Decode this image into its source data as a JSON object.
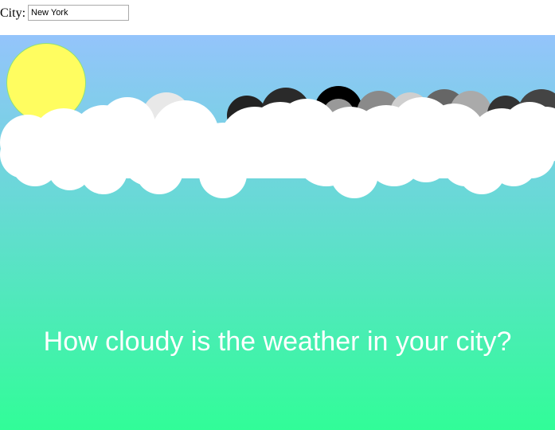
{
  "form": {
    "city_label": "City:",
    "city_value": "New York"
  },
  "scene": {
    "sun_color": "#fffd60",
    "sky_top": "#94c4fb",
    "sky_bottom": "#31fd98",
    "cloud_color": "#ffffff"
  },
  "headline": "How cloudy is the weather in your city?"
}
